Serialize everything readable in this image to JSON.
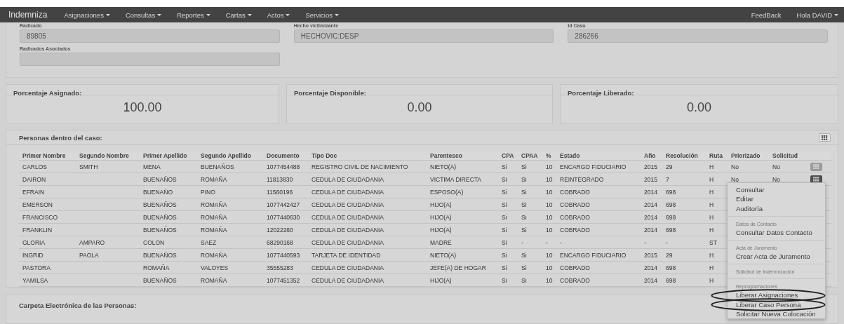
{
  "navbar": {
    "brand": "Indemniza",
    "menus": [
      {
        "label": "Asignaciones",
        "dropdown": true
      },
      {
        "label": "Consultas",
        "dropdown": true
      },
      {
        "label": "Reportes",
        "dropdown": true
      },
      {
        "label": "Cartas",
        "dropdown": true
      },
      {
        "label": "Actos",
        "dropdown": true
      },
      {
        "label": "Servicios",
        "dropdown": true
      }
    ],
    "right": [
      {
        "label": "FeedBack",
        "dropdown": false
      },
      {
        "label": "Hola DAVID",
        "dropdown": true
      }
    ]
  },
  "case_fields": [
    {
      "label": "Radicado",
      "value": "89805"
    },
    {
      "label": "Hecho victimizante",
      "value": "HECHOVIC:DESP"
    },
    {
      "label": "Id Caso",
      "value": "286266"
    },
    {
      "label": "Radicados Asociados"
    }
  ],
  "percentages": [
    {
      "label": "Porcentaje Asignado:",
      "value": "100.00"
    },
    {
      "label": "Porcentaje Disponible:",
      "value": "0.00"
    },
    {
      "label": "Porcentaje Liberado:",
      "value": "0.00"
    }
  ],
  "persons": {
    "title": "Personas dentro del caso:",
    "columns": [
      "Primer Nombre",
      "Segundo Nombre",
      "Primer Apellido",
      "Segundo Apellido",
      "Documento",
      "Tipo Doc",
      "Parentesco",
      "CPA",
      "CPAA",
      "%",
      "Estado",
      "Año",
      "Resolución",
      "Ruta",
      "Priorizado",
      "Solicitud"
    ],
    "rows": [
      {
        "cells": [
          "CARLOS",
          "SMITH",
          "MENA",
          "BUENAÑOS",
          "1077454488",
          "REGISTRO CIVIL DE NACIMIENTO",
          "NIETO(A)",
          "Si",
          "Si",
          "10",
          "ENCARGO FIDUCIARIO",
          "2015",
          "29",
          "H",
          "No",
          "No"
        ],
        "action": {
          "open": false
        }
      },
      {
        "cells": [
          "DAIRON",
          "",
          "BUENAÑOS",
          "ROMAÑA",
          "11813830",
          "CEDULA DE CIUDADANIA",
          "VICTIMA DIRECTA",
          "Si",
          "Si",
          "10",
          "REINTEGRADO",
          "2015",
          "7",
          "H",
          "No",
          "No"
        ],
        "action": {
          "open": true
        }
      },
      {
        "cells": [
          "EFRAIN",
          "",
          "BUENAÑO",
          "PINO",
          "11560196",
          "CEDULA DE CIUDADANIA",
          "ESPOSO(A)",
          "Si",
          "Si",
          "10",
          "COBRADO",
          "2014",
          "698",
          "H"
        ]
      },
      {
        "cells": [
          "EMERSON",
          "",
          "BUENAÑOS",
          "ROMAÑA",
          "1077442427",
          "CEDULA DE CIUDADANIA",
          "HIJO(A)",
          "Si",
          "Si",
          "10",
          "COBRADO",
          "2014",
          "698",
          "H"
        ]
      },
      {
        "cells": [
          "FRANCISCO",
          "",
          "BUENAÑOS",
          "ROMAÑA",
          "1077440630",
          "CEDULA DE CIUDADANIA",
          "HIJO(A)",
          "Si",
          "Si",
          "10",
          "COBRADO",
          "2014",
          "698",
          "H"
        ]
      },
      {
        "cells": [
          "FRANKLIN",
          "",
          "BUENAÑOS",
          "ROMAÑA",
          "12022260",
          "CEDULA DE CIUDADANIA",
          "HIJO(A)",
          "Si",
          "Si",
          "10",
          "COBRADO",
          "2014",
          "698",
          "H"
        ]
      },
      {
        "cells": [
          "GLORIA",
          "AMPARO",
          "COLON",
          "SAEZ",
          "68290168",
          "CEDULA DE CIUDADANIA",
          "MADRE",
          "Si",
          "-",
          "-",
          "-",
          "-",
          "-",
          "ST"
        ]
      },
      {
        "cells": [
          "INGRID",
          "PAOLA",
          "BUENAÑOS",
          "ROMAÑA",
          "1077440593",
          "TARJETA DE IDENTIDAD",
          "NIETO(A)",
          "Si",
          "Si",
          "10",
          "ENCARGO FIDUCIARIO",
          "2015",
          "29",
          "H"
        ]
      },
      {
        "cells": [
          "PASTORA",
          "",
          "ROMAÑA",
          "VALOYES",
          "35555283",
          "CEDULA DE CIUDADANIA",
          "JEFE(A) DE HOGAR",
          "Si",
          "Si",
          "10",
          "COBRADO",
          "2014",
          "698",
          "H"
        ]
      },
      {
        "cells": [
          "YAMILSA",
          "",
          "BUENAÑOS",
          "ROMAÑA",
          "1077451352",
          "CEDULA DE CIUDADANIA",
          "HIJO(A)",
          "Si",
          "Si",
          "10",
          "COBRADO",
          "2014",
          "698",
          "H"
        ]
      }
    ]
  },
  "row_menu": {
    "items": [
      {
        "kind": "item",
        "label": "Consultar"
      },
      {
        "kind": "item",
        "label": "Editar"
      },
      {
        "kind": "item",
        "label": "Auditoría"
      },
      {
        "kind": "divider"
      },
      {
        "kind": "header",
        "label": "Datos de Contacto"
      },
      {
        "kind": "item",
        "label": "Consultar Datos Contacto"
      },
      {
        "kind": "divider"
      },
      {
        "kind": "header",
        "label": "Acta de Juramento"
      },
      {
        "kind": "item",
        "label": "Crear Acta de Juramento"
      },
      {
        "kind": "divider"
      },
      {
        "kind": "header",
        "label": "Solicitud de Indemnización"
      },
      {
        "kind": "divider"
      },
      {
        "kind": "header",
        "label": "Reprogramaciones"
      },
      {
        "kind": "item",
        "label": "Liberar Asignaciones",
        "circled": true
      },
      {
        "kind": "item",
        "label": "Liberar Caso Persona",
        "circled": true
      },
      {
        "kind": "item",
        "label": "Solicitar Nueva Colocación",
        "circled": false
      }
    ]
  },
  "next_panel": {
    "title": "Carpeta Electrónica de las Personas:"
  }
}
